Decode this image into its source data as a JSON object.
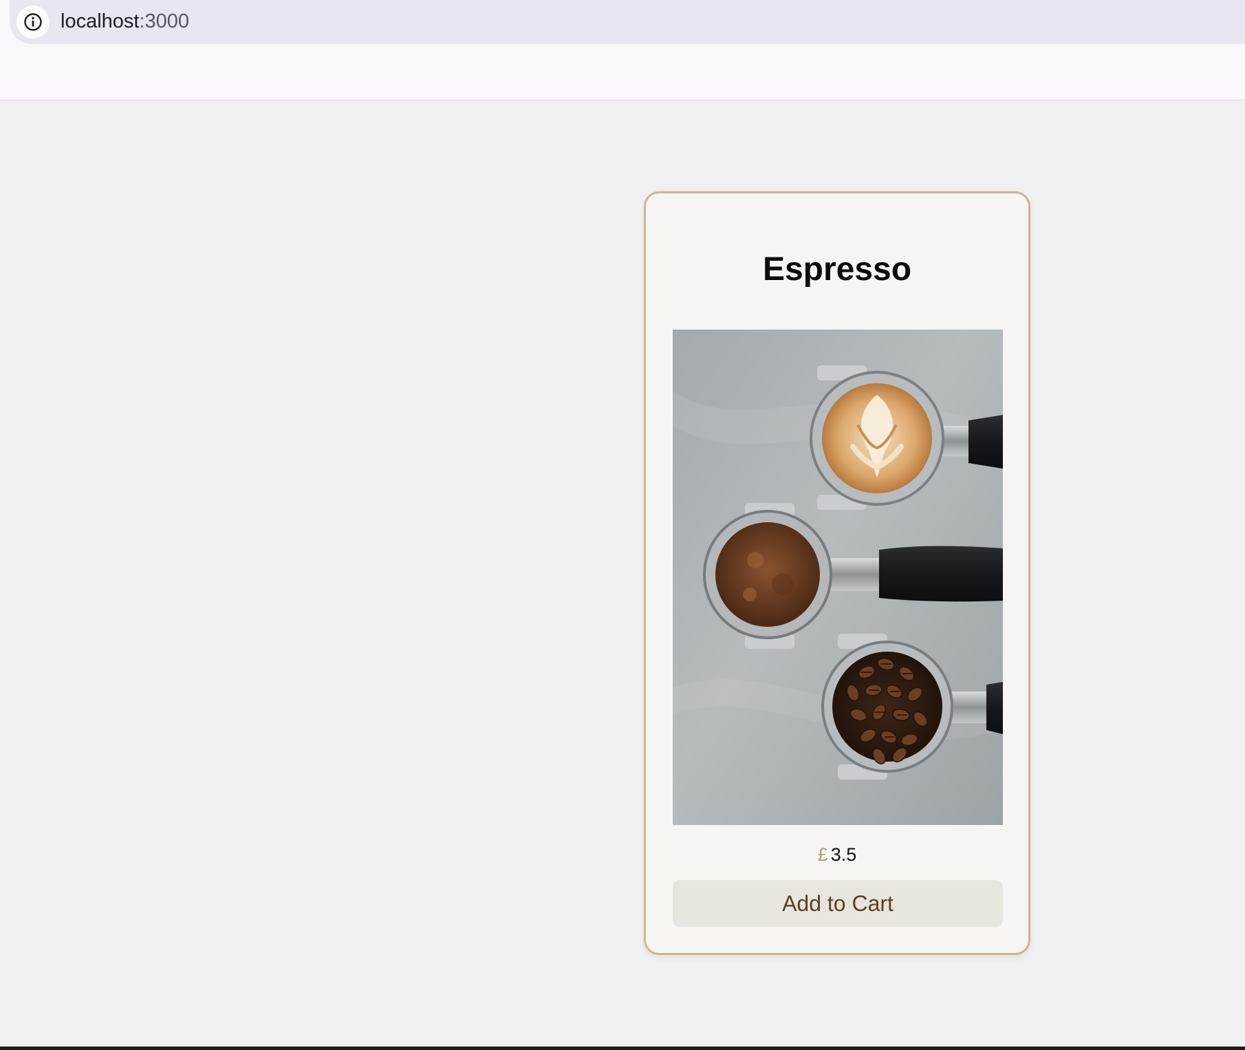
{
  "browser": {
    "url_host": "localhost",
    "url_port": ":3000",
    "info_icon": "info-icon"
  },
  "product": {
    "title": "Espresso",
    "image_icon": "espresso-portafilters-photo",
    "currency_symbol": "£",
    "price": "3.5",
    "add_to_cart_label": "Add to Cart"
  },
  "colors": {
    "page_background": "#f0f0f0",
    "card_background": "#f6f5f3",
    "card_border": "#cdb590",
    "button_background": "#e8e5dd",
    "button_text": "#5b4025",
    "currency_accent": "#b89a74"
  }
}
